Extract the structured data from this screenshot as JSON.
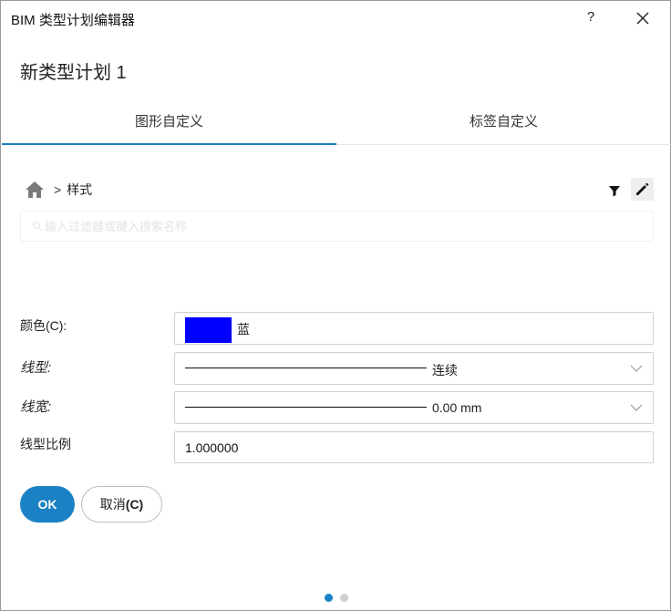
{
  "window": {
    "title": "BIM 类型计划编辑器",
    "help_label": "?"
  },
  "heading": "新类型计划 1",
  "tabs": [
    {
      "label": "图形自定义",
      "active": true
    },
    {
      "label": "标签自定义",
      "active": false
    }
  ],
  "breadcrumb": {
    "separator": ">",
    "current": "样式"
  },
  "search": {
    "placeholder": "输入过滤器或键入搜索名称"
  },
  "properties": {
    "color": {
      "label": "颜色(C):",
      "value": "蓝",
      "swatch": "#0000ff"
    },
    "linetype": {
      "label": "线型:",
      "value": "连续"
    },
    "lineweight": {
      "label": "线宽:",
      "value": "0.00 mm"
    },
    "linetype_scale": {
      "label": "线型比例",
      "value": "1.000000"
    }
  },
  "buttons": {
    "ok": "OK",
    "cancel": "取消",
    "cancel_shortcut": "(C)"
  },
  "pagination": {
    "total": 2,
    "current": 1
  },
  "accent_color": "#1a82c4"
}
